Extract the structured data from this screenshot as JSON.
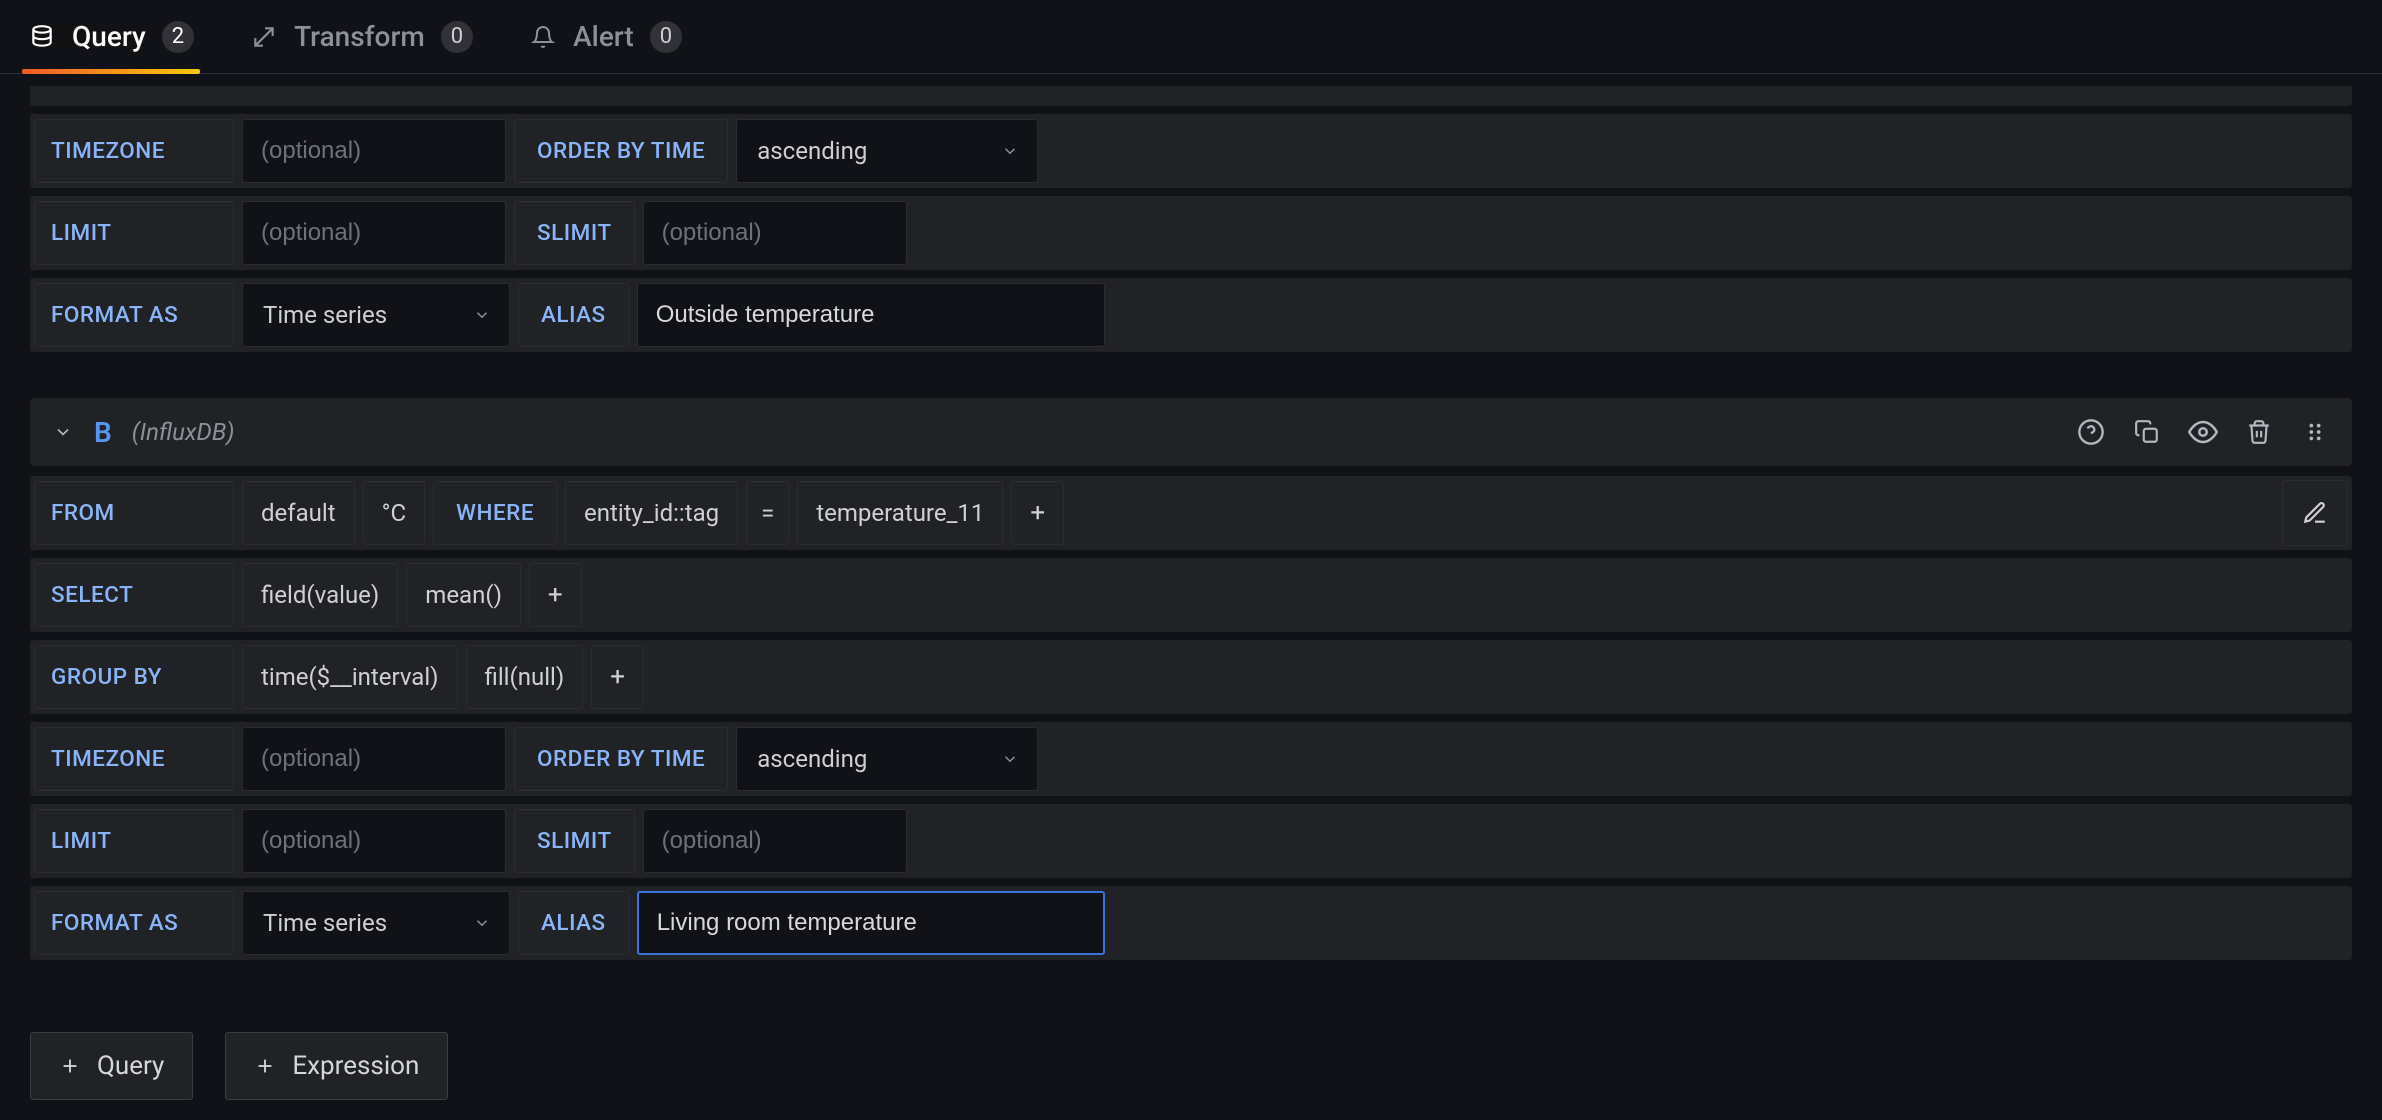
{
  "tabs": {
    "query": {
      "label": "Query",
      "count": "2"
    },
    "transform": {
      "label": "Transform",
      "count": "0"
    },
    "alert": {
      "label": "Alert",
      "count": "0"
    }
  },
  "labels": {
    "from": "FROM",
    "where": "WHERE",
    "select": "SELECT",
    "group_by": "GROUP BY",
    "timezone": "TIMEZONE",
    "order_by_time": "ORDER BY TIME",
    "limit": "LIMIT",
    "slimit": "SLIMIT",
    "format_as": "FORMAT AS",
    "alias": "ALIAS",
    "plus": "+"
  },
  "placeholders": {
    "optional": "(optional)"
  },
  "query_a": {
    "timezone": "",
    "order_by_time": "ascending",
    "limit": "",
    "slimit": "",
    "format_as": "Time series",
    "alias": "Outside temperature"
  },
  "query_b": {
    "letter": "B",
    "datasource": "(InfluxDB)",
    "from_default": "default",
    "from_measurement": "°C",
    "where_field": "entity_id::tag",
    "where_op": "=",
    "where_value": "temperature_11",
    "select_field": "field(value)",
    "select_agg": "mean()",
    "groupby_time": "time($__interval)",
    "groupby_fill": "fill(null)",
    "timezone": "",
    "order_by_time": "ascending",
    "limit": "",
    "slimit": "",
    "format_as": "Time series",
    "alias": "Living room temperature"
  },
  "footer": {
    "query": "Query",
    "expression": "Expression"
  }
}
